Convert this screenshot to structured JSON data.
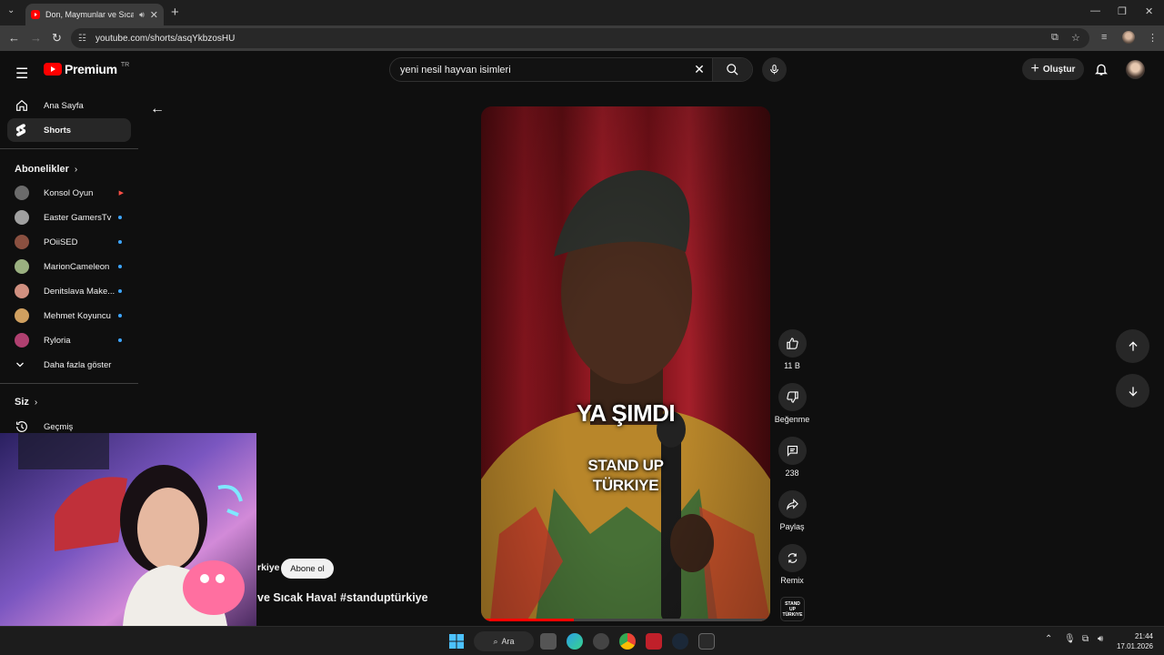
{
  "browser": {
    "tab_title": "Don, Maymunlar ve Sıcak H",
    "url": "youtube.com/shorts/asqYkbzosHU"
  },
  "header": {
    "logo_word": "Premium",
    "country_code": "TR",
    "search_value": "yeni nesil hayvan isimleri",
    "create_label": "Oluştur"
  },
  "sidebar": {
    "home": "Ana Sayfa",
    "shorts": "Shorts",
    "subscriptions_heading": "Abonelikler",
    "subscriptions": [
      {
        "name": "Konsol Oyun",
        "color": "#6b6b6b",
        "live": true
      },
      {
        "name": "Easter GamersTv",
        "color": "#a0a0a0",
        "live": false
      },
      {
        "name": "POiiSED",
        "color": "#8a5040",
        "live": false
      },
      {
        "name": "MarionCameleon",
        "color": "#9ab080",
        "live": false
      },
      {
        "name": "Denitslava Make...",
        "color": "#d09080",
        "live": false
      },
      {
        "name": "Mehmet Koyuncu",
        "color": "#d0a060",
        "live": false
      },
      {
        "name": "Ryloria",
        "color": "#b04070",
        "live": false
      }
    ],
    "show_more": "Daha fazla göster",
    "you_heading": "Siz",
    "history": "Geçmiş"
  },
  "video": {
    "caption_main": "YA ŞIMDI",
    "watermark_line1": "STAND UP",
    "watermark_line2": "TÜRKIYE",
    "channel_name_partial": "rkiye",
    "subscribe_label": "Abone ol",
    "title_partial": "ve Sıcak Hava! #standuptürkiye"
  },
  "actions": {
    "like_count": "11 B",
    "dislike_label": "Beğenme",
    "comment_count": "238",
    "share_label": "Paylaş",
    "remix_label": "Remix",
    "thumb_text": "STAND UP TÜRKIYE"
  },
  "taskbar": {
    "search_label": "Ara",
    "time": "21:44",
    "date": "17.01.2026"
  },
  "colors": {
    "youtube_red": "#ff0000",
    "background": "#0f0f0f",
    "chip": "#272727",
    "accent_blue": "#3ea6ff"
  }
}
